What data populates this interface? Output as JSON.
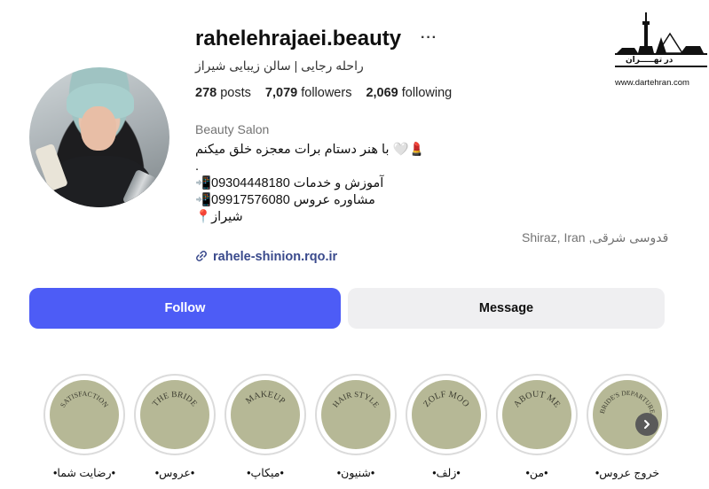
{
  "profile": {
    "username": "rahelehrajaei.beauty",
    "more_label": "···",
    "full_name": "راحله رجایی | سالن زیبایی شیراز",
    "stats": {
      "posts_count": "278",
      "posts_label": "posts",
      "followers_count": "7,079",
      "followers_label": "followers",
      "following_count": "2,069",
      "following_label": "following"
    },
    "category": "Beauty Salon",
    "bio_lines": [
      "با هنر دستام برات معجزه خلق میکنم 🤍💄",
      ".",
      "📲09304448180 آموزش و خدمات",
      "📲09917576080 مشاوره عروس",
      "📍شیراز"
    ],
    "location": "Shiraz, Iran ,قدوسی شرقی",
    "link": "rahele-shinion.rqo.ir"
  },
  "actions": {
    "follow": "Follow",
    "message": "Message"
  },
  "highlights": [
    {
      "label": "•خروج عروس",
      "cover_text": "BRIDE'S DEPARTURE"
    },
    {
      "label": "•من•",
      "cover_text": "ABOUT ME"
    },
    {
      "label": "•زلف•",
      "cover_text": "ZOLF MOO"
    },
    {
      "label": "•شنیون•",
      "cover_text": "HAIR STYLE"
    },
    {
      "label": "•میکاپ•",
      "cover_text": "MAKEUP"
    },
    {
      "label": "•عروس•",
      "cover_text": "THE BRIDE"
    },
    {
      "label": "•رضایت شما•",
      "cover_text": "SATISFACTION"
    }
  ],
  "watermark": {
    "brand": "در تهـــــران",
    "url": "www.dartehran.com"
  },
  "colors": {
    "follow_bg": "#4d5cf6",
    "message_bg": "#efeff1",
    "highlight_cover": "#b6b896",
    "link": "#3a4a8c"
  }
}
